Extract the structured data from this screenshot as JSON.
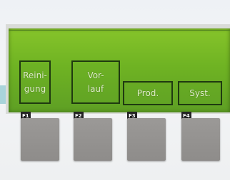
{
  "softkeys": [
    {
      "line1": "Reini-",
      "line2": "gung"
    },
    {
      "line1": "Vor-",
      "line2": "lauf"
    },
    {
      "line1": "Prod."
    },
    {
      "line1": "Syst."
    }
  ],
  "function_keys": [
    "F1",
    "F2",
    "F3",
    "F4"
  ],
  "colors": {
    "lcd_green": "#6fb323",
    "lcd_text": "#e2f0c8",
    "button_gray": "#8e8c8a",
    "teal_strip": "#a9d4da"
  }
}
